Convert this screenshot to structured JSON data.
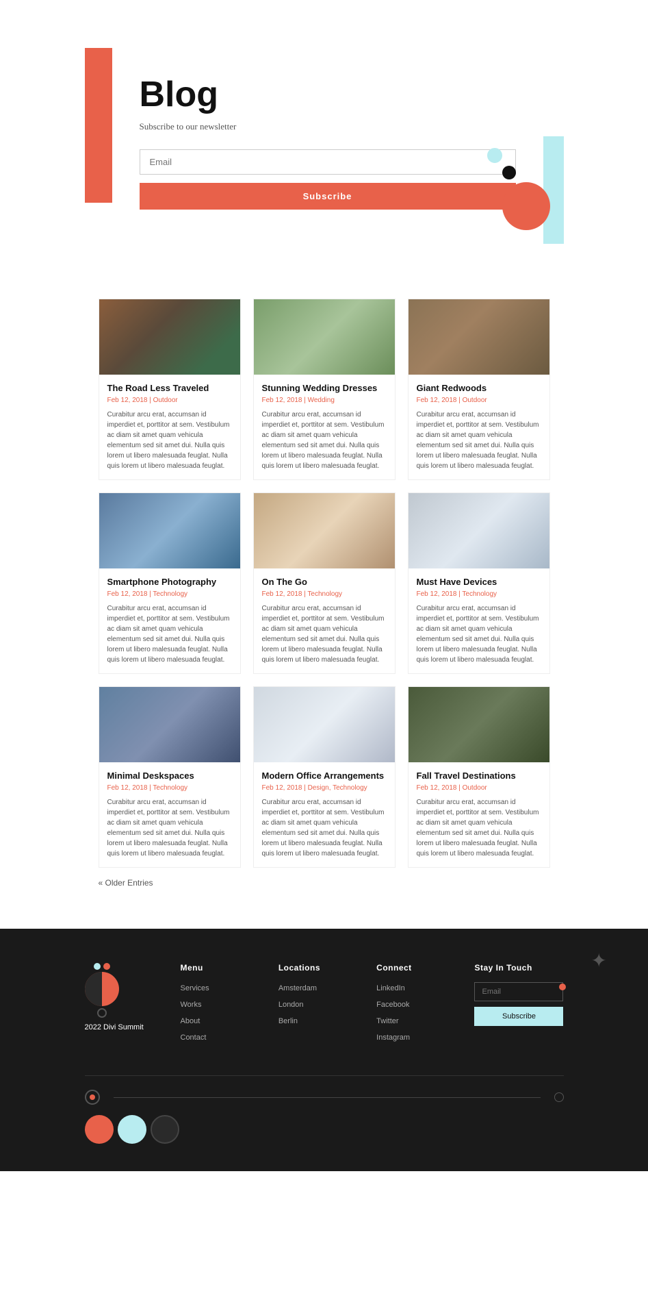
{
  "hero": {
    "title": "Blog",
    "subtitle": "Subscribe to our newsletter",
    "email_placeholder": "Email",
    "subscribe_label": "Subscribe"
  },
  "blog": {
    "posts": [
      {
        "id": 1,
        "title": "The Road Less Traveled",
        "meta": "Feb 12, 2018 | Outdoor",
        "excerpt": "Curabitur arcu erat, accumsan id imperdiet et, porttitor at sem. Vestibulum ac diam sit amet quam vehicula elementum sed sit amet dui. Nulla quis lorem ut libero malesuada feuglat. Nulla quis lorem ut libero malesuada feuglat.",
        "img_class": "img-road"
      },
      {
        "id": 2,
        "title": "Stunning Wedding Dresses",
        "meta": "Feb 12, 2018 | Wedding",
        "excerpt": "Curabitur arcu erat, accumsan id imperdiet et, porttitor at sem. Vestibulum ac diam sit amet quam vehicula elementum sed sit amet dui. Nulla quis lorem ut libero malesuada feuglat. Nulla quis lorem ut libero malesuada feuglat.",
        "img_class": "img-wedding"
      },
      {
        "id": 3,
        "title": "Giant Redwoods",
        "meta": "Feb 12, 2018 | Outdoor",
        "excerpt": "Curabitur arcu erat, accumsan id imperdiet et, porttitor at sem. Vestibulum ac diam sit amet quam vehicula elementum sed sit amet dui. Nulla quis lorem ut libero malesuada feuglat. Nulla quis lorem ut libero malesuada feuglat.",
        "img_class": "img-redwoods"
      },
      {
        "id": 4,
        "title": "Smartphone Photography",
        "meta": "Feb 12, 2018 | Technology",
        "excerpt": "Curabitur arcu erat, accumsan id imperdiet et, porttitor at sem. Vestibulum ac diam sit amet quam vehicula elementum sed sit amet dui. Nulla quis lorem ut libero malesuada feuglat. Nulla quis lorem ut libero malesuada feuglat.",
        "img_class": "img-smartphone"
      },
      {
        "id": 5,
        "title": "On The Go",
        "meta": "Feb 12, 2018 | Technology",
        "excerpt": "Curabitur arcu erat, accumsan id imperdiet et, porttitor at sem. Vestibulum ac diam sit amet quam vehicula elementum sed sit amet dui. Nulla quis lorem ut libero malesuada feuglat. Nulla quis lorem ut libero malesuada feuglat.",
        "img_class": "img-onthego"
      },
      {
        "id": 6,
        "title": "Must Have Devices",
        "meta": "Feb 12, 2018 | Technology",
        "excerpt": "Curabitur arcu erat, accumsan id imperdiet et, porttitor at sem. Vestibulum ac diam sit amet quam vehicula elementum sed sit amet dui. Nulla quis lorem ut libero malesuada feuglat. Nulla quis lorem ut libero malesuada feuglat.",
        "img_class": "img-devices"
      },
      {
        "id": 7,
        "title": "Minimal Deskspaces",
        "meta": "Feb 12, 2018 | Technology",
        "excerpt": "Curabitur arcu erat, accumsan id imperdiet et, porttitor at sem. Vestibulum ac diam sit amet quam vehicula elementum sed sit amet dui. Nulla quis lorem ut libero malesuada feuglat. Nulla quis lorem ut libero malesuada feuglat.",
        "img_class": "img-desk"
      },
      {
        "id": 8,
        "title": "Modern Office Arrangements",
        "meta": "Feb 12, 2018 | Design, Technology",
        "excerpt": "Curabitur arcu erat, accumsan id imperdiet et, porttitor at sem. Vestibulum ac diam sit amet quam vehicula elementum sed sit amet dui. Nulla quis lorem ut libero malesuada feuglat. Nulla quis lorem ut libero malesuada feuglat.",
        "img_class": "img-office"
      },
      {
        "id": 9,
        "title": "Fall Travel Destinations",
        "meta": "Feb 12, 2018 | Outdoor",
        "excerpt": "Curabitur arcu erat, accumsan id imperdiet et, porttitor at sem. Vestibulum ac diam sit amet quam vehicula elementum sed sit amet dui. Nulla quis lorem ut libero malesuada feuglat. Nulla quis lorem ut libero malesuada feuglat.",
        "img_class": "img-pinecone"
      }
    ],
    "older_entries_label": "« Older Entries"
  },
  "footer": {
    "brand": "2022 Divi Summit",
    "menu_heading": "Menu",
    "locations_heading": "Locations",
    "connect_heading": "Connect",
    "stay_heading": "Stay In Touch",
    "menu_items": [
      "Services",
      "Works",
      "About",
      "Contact"
    ],
    "locations": [
      "Amsterdam",
      "London",
      "Berlin"
    ],
    "connect": [
      "LinkedIn",
      "Facebook",
      "Twitter",
      "Instagram"
    ],
    "email_placeholder": "Email",
    "subscribe_label": "Subscribe"
  }
}
